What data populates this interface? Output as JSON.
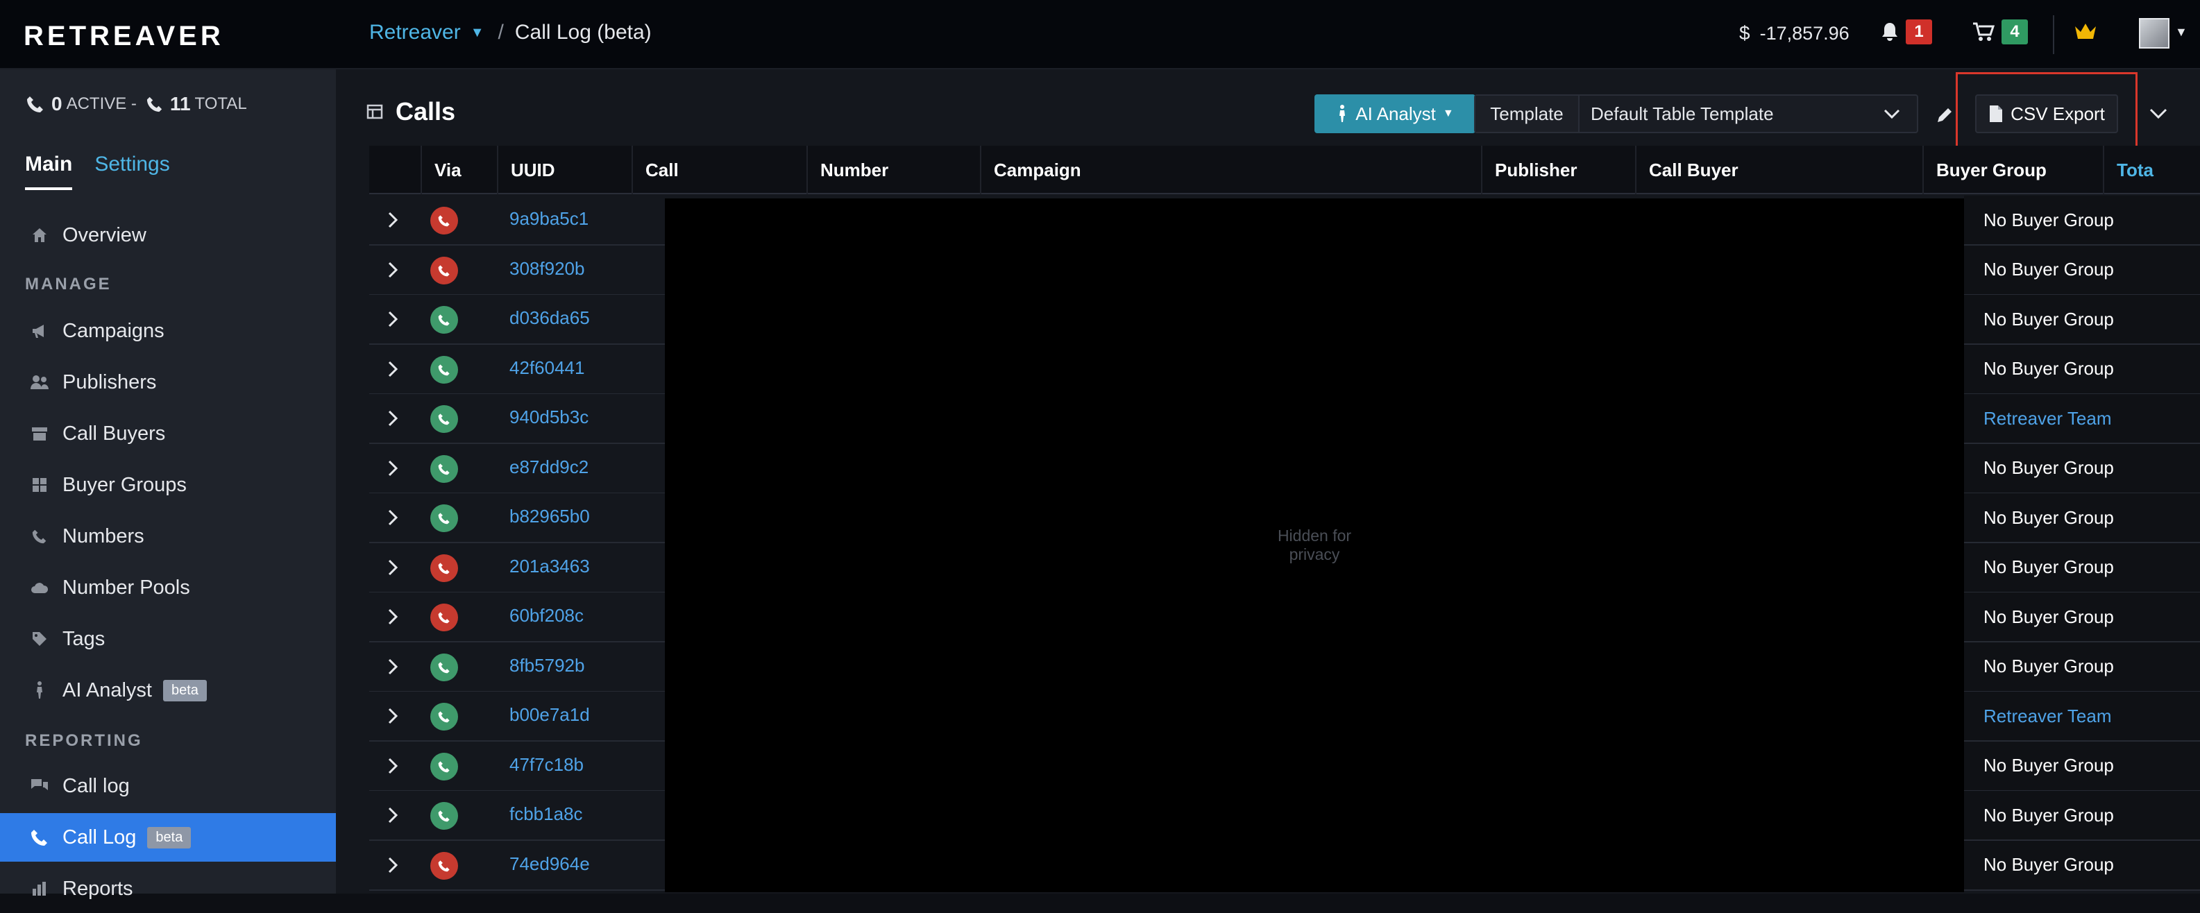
{
  "header": {
    "logo": "RETREAVER",
    "breadcrumb_root": "Retreaver",
    "breadcrumb_sep": "/",
    "breadcrumb_page": "Call Log (beta)",
    "balance": "-17,857.96",
    "notifications_count": "1",
    "cart_count": "4"
  },
  "sidebar": {
    "active_calls": "0",
    "active_label": "ACTIVE -",
    "total_calls": "11",
    "total_label": "TOTAL",
    "tabs": {
      "main": "Main",
      "settings": "Settings"
    },
    "overview": "Overview",
    "manage_label": "MANAGE",
    "items": [
      {
        "label": "Campaigns",
        "icon": "megaphone-icon"
      },
      {
        "label": "Publishers",
        "icon": "users-icon"
      },
      {
        "label": "Call Buyers",
        "icon": "box-icon"
      },
      {
        "label": "Buyer Groups",
        "icon": "grid-icon"
      },
      {
        "label": "Numbers",
        "icon": "phone-icon"
      },
      {
        "label": "Number Pools",
        "icon": "cloud-icon"
      },
      {
        "label": "Tags",
        "icon": "tag-icon"
      }
    ],
    "ai_analyst": "AI Analyst",
    "beta": "beta",
    "reporting_label": "REPORTING",
    "call_log": "Call log",
    "call_log_beta": "Call Log",
    "cut_item": "Reports"
  },
  "toolbar": {
    "title": "Calls",
    "ai_analyst": "AI Analyst",
    "template_label": "Template",
    "template_value": "Default Table Template",
    "csv_export": "CSV Export"
  },
  "table": {
    "columns": [
      "Via",
      "UUID",
      "Call",
      "Number",
      "Campaign",
      "Publisher",
      "Call Buyer",
      "Buyer Group",
      "Tota"
    ],
    "privacy_text": "Hidden for\nprivacy",
    "rows": [
      {
        "uuid": "9a9ba5c1",
        "via": "red",
        "buyer_group": "No Buyer Group"
      },
      {
        "uuid": "308f920b",
        "via": "red",
        "buyer_group": "No Buyer Group"
      },
      {
        "uuid": "d036da65",
        "via": "green",
        "buyer_group": "No Buyer Group"
      },
      {
        "uuid": "42f60441",
        "via": "green",
        "buyer_group": "No Buyer Group"
      },
      {
        "uuid": "940d5b3c",
        "via": "green",
        "buyer_group": "Retreaver Team"
      },
      {
        "uuid": "e87dd9c2",
        "via": "green",
        "buyer_group": "No Buyer Group"
      },
      {
        "uuid": "b82965b0",
        "via": "green",
        "buyer_group": "No Buyer Group"
      },
      {
        "uuid": "201a3463",
        "via": "red",
        "buyer_group": "No Buyer Group"
      },
      {
        "uuid": "60bf208c",
        "via": "red",
        "buyer_group": "No Buyer Group"
      },
      {
        "uuid": "8fb5792b",
        "via": "green",
        "buyer_group": "No Buyer Group"
      },
      {
        "uuid": "b00e7a1d",
        "via": "green",
        "buyer_group": "Retreaver Team"
      },
      {
        "uuid": "47f7c18b",
        "via": "green",
        "buyer_group": "No Buyer Group"
      },
      {
        "uuid": "fcbb1a8c",
        "via": "green",
        "buyer_group": "No Buyer Group"
      },
      {
        "uuid": "74ed964e",
        "via": "red",
        "buyer_group": "No Buyer Group"
      }
    ]
  },
  "colors": {
    "accent_blue": "#4fb6e6",
    "active_nav": "#2f7be6",
    "call_red": "#c63a2f",
    "call_green": "#3f9a6b",
    "highlight": "#d9372b"
  }
}
